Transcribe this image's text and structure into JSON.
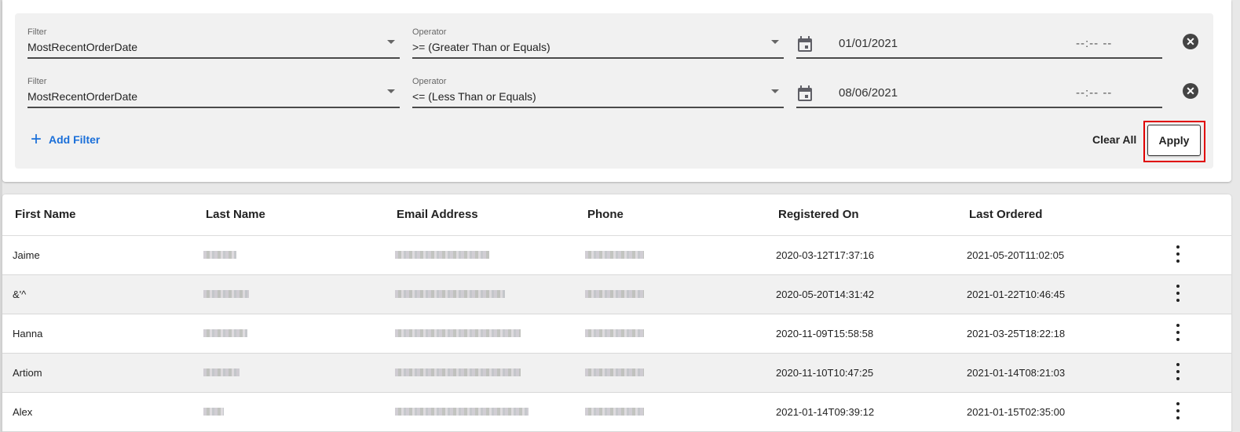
{
  "filters": [
    {
      "filter_label": "Filter",
      "filter_value": "MostRecentOrderDate",
      "operator_label": "Operator",
      "operator_value": ">= (Greater Than or Equals)",
      "date_value": "01/01/2021",
      "time_value": "--:-- --"
    },
    {
      "filter_label": "Filter",
      "filter_value": "MostRecentOrderDate",
      "operator_label": "Operator",
      "operator_value": "<= (Less Than or Equals)",
      "date_value": "08/06/2021",
      "time_value": "--:-- --"
    }
  ],
  "actions": {
    "add_filter_icon": "+",
    "add_filter_label": "Add Filter",
    "clear_all_label": "Clear All",
    "apply_label": "Apply",
    "remove_icon": "✕"
  },
  "colors": {
    "accent": "#1a6fd9",
    "highlight": "#e00000",
    "panel_bg": "#f1f1f1"
  },
  "table": {
    "columns": [
      "First Name",
      "Last Name",
      "Email Address",
      "Phone",
      "Registered On",
      "Last Ordered"
    ],
    "rows": [
      {
        "first_name": "Jaime",
        "last_name": "[redacted]",
        "email": "[redacted]",
        "phone": "[redacted]",
        "registered_on": "2020-03-12T17:37:16",
        "last_ordered": "2021-05-20T11:02:05"
      },
      {
        "first_name": "&'^",
        "last_name": "[redacted]",
        "email": "[redacted]",
        "phone": "[redacted]",
        "registered_on": "2020-05-20T14:31:42",
        "last_ordered": "2021-01-22T10:46:45"
      },
      {
        "first_name": "Hanna",
        "last_name": "[redacted]",
        "email": "[redacted]",
        "phone": "[redacted]",
        "registered_on": "2020-11-09T15:58:58",
        "last_ordered": "2021-03-25T18:22:18"
      },
      {
        "first_name": "Artiom",
        "last_name": "[redacted]",
        "email": "[redacted]",
        "phone": "[redacted]",
        "registered_on": "2020-11-10T10:47:25",
        "last_ordered": "2021-01-14T08:21:03"
      },
      {
        "first_name": "Alex",
        "last_name": "[redacted]",
        "email": "[redacted]",
        "phone": "[redacted]",
        "registered_on": "2021-01-14T09:39:12",
        "last_ordered": "2021-01-15T02:35:00"
      }
    ]
  }
}
